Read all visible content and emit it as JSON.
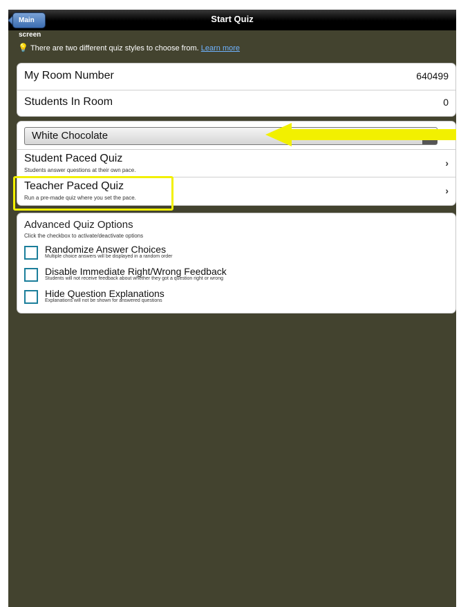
{
  "navbar": {
    "back_label": "Main screen",
    "title": "Start Quiz"
  },
  "info": {
    "text": "There are two different quiz styles to choose from.",
    "link": "Learn more"
  },
  "room": {
    "room_label": "My Room Number",
    "room_value": "640499",
    "students_label": "Students In Room",
    "students_value": "0"
  },
  "quiz": {
    "selected_quiz": "White Chocolate",
    "student_paced": {
      "title": "Student Paced Quiz",
      "subtitle": "Students answer questions at their own pace."
    },
    "teacher_paced": {
      "title": "Teacher Paced Quiz",
      "subtitle": "Run a pre-made quiz where you set the pace."
    }
  },
  "advanced": {
    "title": "Advanced Quiz Options",
    "subtitle": "Click the checkbox to activate/deactivate options",
    "options": [
      {
        "title": "Randomize Answer Choices",
        "subtitle": "Multiple choice answers will be displayed in a random order",
        "checked": false
      },
      {
        "title": "Disable Immediate Right/Wrong Feedback",
        "subtitle": "Students will not receive feedback about whether they got a question right or wrong",
        "checked": false
      },
      {
        "title": "Hide Question Explanations",
        "subtitle": "Explanations will not be shown for answered questions",
        "checked": false
      }
    ]
  },
  "colors": {
    "annotation": "#f2f000",
    "checkbox_border": "#1a7e9a",
    "background": "#43432f"
  }
}
